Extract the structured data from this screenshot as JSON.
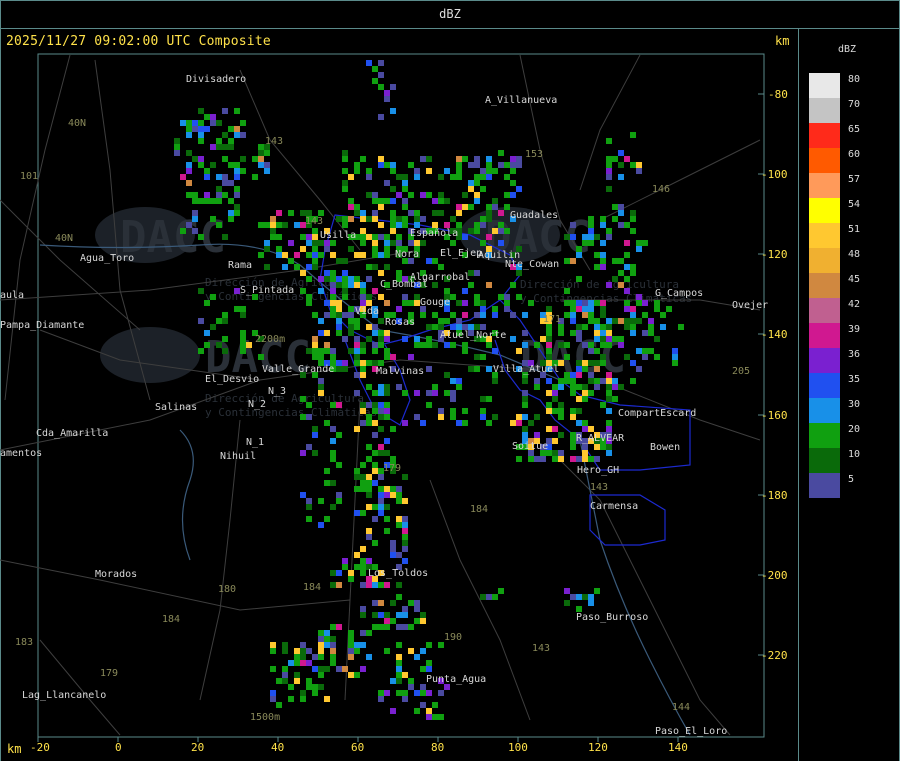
{
  "header": {
    "title": "dBZ"
  },
  "map": {
    "timestamp": "2025/11/27 09:02:00 UTC Composite",
    "unit_top": "km",
    "unit_bottom": "km",
    "y_ticks": [
      "-80",
      "-100",
      "-120",
      "-140",
      "-160",
      "-180",
      "-200",
      "-220"
    ],
    "x_ticks": [
      "-20",
      "0",
      "20",
      "40",
      "60",
      "80",
      "100",
      "120",
      "140"
    ],
    "places": [
      {
        "name": "Divisadero"
      },
      {
        "name": "A_Villanueva"
      },
      {
        "name": "Guadales"
      },
      {
        "name": "Usilla"
      },
      {
        "name": "Española"
      },
      {
        "name": "El_Ejep"
      },
      {
        "name": "Aquilin"
      },
      {
        "name": "Nte_Cowan"
      },
      {
        "name": "Rama"
      },
      {
        "name": "Nora"
      },
      {
        "name": "C_Bombal"
      },
      {
        "name": "Algarrobal"
      },
      {
        "name": "S_Pintada"
      },
      {
        "name": "Gouge"
      },
      {
        "name": "Vida"
      },
      {
        "name": "Rosas"
      },
      {
        "name": "Atuel_Norte"
      },
      {
        "name": "Villa_Atuel"
      },
      {
        "name": "Valle_Grande"
      },
      {
        "name": "Malvinas"
      },
      {
        "name": "El_Desvio"
      },
      {
        "name": "Salinas"
      },
      {
        "name": "N_2"
      },
      {
        "name": "N_3"
      },
      {
        "name": "N_1"
      },
      {
        "name": "Nihuil"
      },
      {
        "name": "Cda_Amarilla"
      },
      {
        "name": "amentos"
      },
      {
        "name": "Agua_Toro"
      },
      {
        "name": "aula"
      },
      {
        "name": "Pampa_Diamante"
      },
      {
        "name": "Soitue"
      },
      {
        "name": "R_ALVEAR"
      },
      {
        "name": "CompartEscard"
      },
      {
        "name": "Bowen"
      },
      {
        "name": "Hero_GH"
      },
      {
        "name": "Carmensa"
      },
      {
        "name": "Los_Toldos"
      },
      {
        "name": "Morados"
      },
      {
        "name": "Paso_Burroso"
      },
      {
        "name": "Punta_Agua"
      },
      {
        "name": "Lag_Llancanelo"
      },
      {
        "name": "Paso_El_Loro"
      },
      {
        "name": "Ovejer"
      },
      {
        "name": "G_Campos"
      }
    ],
    "route_labels": [
      "40N",
      "101",
      "40N",
      "143",
      "153",
      "146",
      "171",
      "143",
      "205",
      "179",
      "184",
      "180",
      "184",
      "184",
      "183",
      "179",
      "190",
      "143",
      "143",
      "144",
      "2200m",
      "1500m"
    ],
    "watermark": {
      "text": "DACC",
      "sub1": "Dirección de Agricultura",
      "sub2": "y Contingencias Climáticas"
    }
  },
  "legend": {
    "unit": "dBZ",
    "levels": [
      {
        "value": "80",
        "color": "#e8e8e8"
      },
      {
        "value": "70",
        "color": "#c4c4c4"
      },
      {
        "value": "65",
        "color": "#ff2a1a"
      },
      {
        "value": "60",
        "color": "#ff5a00"
      },
      {
        "value": "57",
        "color": "#ff9a5a"
      },
      {
        "value": "54",
        "color": "#ffff00"
      },
      {
        "value": "51",
        "color": "#ffc830"
      },
      {
        "value": "48",
        "color": "#f0b030"
      },
      {
        "value": "45",
        "color": "#d08840"
      },
      {
        "value": "42",
        "color": "#c06090"
      },
      {
        "value": "39",
        "color": "#d01890"
      },
      {
        "value": "36",
        "color": "#7a20d0"
      },
      {
        "value": "35",
        "color": "#2050f0"
      },
      {
        "value": "30",
        "color": "#1890e8"
      },
      {
        "value": "20",
        "color": "#10a010"
      },
      {
        "value": "10",
        "color": "#0a6a0a"
      },
      {
        "value": "5",
        "color": "#4a4aa0"
      }
    ]
  }
}
